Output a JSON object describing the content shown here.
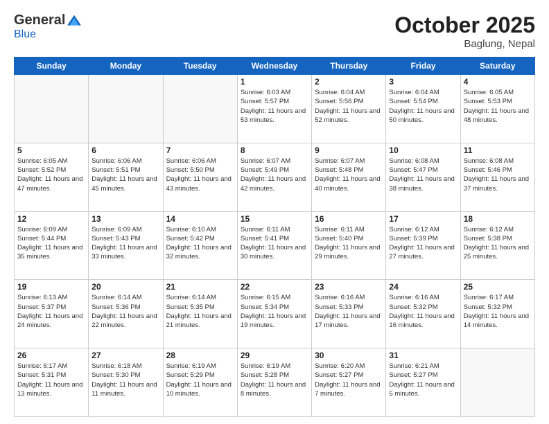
{
  "header": {
    "logo_general": "General",
    "logo_blue": "Blue",
    "title": "October 2025",
    "location": "Baglung, Nepal"
  },
  "calendar": {
    "days_of_week": [
      "Sunday",
      "Monday",
      "Tuesday",
      "Wednesday",
      "Thursday",
      "Friday",
      "Saturday"
    ],
    "weeks": [
      [
        {
          "day": "",
          "empty": true
        },
        {
          "day": "",
          "empty": true
        },
        {
          "day": "",
          "empty": true
        },
        {
          "day": "1",
          "sunrise": "6:03 AM",
          "sunset": "5:57 PM",
          "daylight": "11 hours and 53 minutes."
        },
        {
          "day": "2",
          "sunrise": "6:04 AM",
          "sunset": "5:56 PM",
          "daylight": "11 hours and 52 minutes."
        },
        {
          "day": "3",
          "sunrise": "6:04 AM",
          "sunset": "5:54 PM",
          "daylight": "11 hours and 50 minutes."
        },
        {
          "day": "4",
          "sunrise": "6:05 AM",
          "sunset": "5:53 PM",
          "daylight": "11 hours and 48 minutes."
        }
      ],
      [
        {
          "day": "5",
          "sunrise": "6:05 AM",
          "sunset": "5:52 PM",
          "daylight": "11 hours and 47 minutes."
        },
        {
          "day": "6",
          "sunrise": "6:06 AM",
          "sunset": "5:51 PM",
          "daylight": "11 hours and 45 minutes."
        },
        {
          "day": "7",
          "sunrise": "6:06 AM",
          "sunset": "5:50 PM",
          "daylight": "11 hours and 43 minutes."
        },
        {
          "day": "8",
          "sunrise": "6:07 AM",
          "sunset": "5:49 PM",
          "daylight": "11 hours and 42 minutes."
        },
        {
          "day": "9",
          "sunrise": "6:07 AM",
          "sunset": "5:48 PM",
          "daylight": "11 hours and 40 minutes."
        },
        {
          "day": "10",
          "sunrise": "6:08 AM",
          "sunset": "5:47 PM",
          "daylight": "11 hours and 38 minutes."
        },
        {
          "day": "11",
          "sunrise": "6:08 AM",
          "sunset": "5:46 PM",
          "daylight": "11 hours and 37 minutes."
        }
      ],
      [
        {
          "day": "12",
          "sunrise": "6:09 AM",
          "sunset": "5:44 PM",
          "daylight": "11 hours and 35 minutes."
        },
        {
          "day": "13",
          "sunrise": "6:09 AM",
          "sunset": "5:43 PM",
          "daylight": "11 hours and 33 minutes."
        },
        {
          "day": "14",
          "sunrise": "6:10 AM",
          "sunset": "5:42 PM",
          "daylight": "11 hours and 32 minutes."
        },
        {
          "day": "15",
          "sunrise": "6:11 AM",
          "sunset": "5:41 PM",
          "daylight": "11 hours and 30 minutes."
        },
        {
          "day": "16",
          "sunrise": "6:11 AM",
          "sunset": "5:40 PM",
          "daylight": "11 hours and 29 minutes."
        },
        {
          "day": "17",
          "sunrise": "6:12 AM",
          "sunset": "5:39 PM",
          "daylight": "11 hours and 27 minutes."
        },
        {
          "day": "18",
          "sunrise": "6:12 AM",
          "sunset": "5:38 PM",
          "daylight": "11 hours and 25 minutes."
        }
      ],
      [
        {
          "day": "19",
          "sunrise": "6:13 AM",
          "sunset": "5:37 PM",
          "daylight": "11 hours and 24 minutes."
        },
        {
          "day": "20",
          "sunrise": "6:14 AM",
          "sunset": "5:36 PM",
          "daylight": "11 hours and 22 minutes."
        },
        {
          "day": "21",
          "sunrise": "6:14 AM",
          "sunset": "5:35 PM",
          "daylight": "11 hours and 21 minutes."
        },
        {
          "day": "22",
          "sunrise": "6:15 AM",
          "sunset": "5:34 PM",
          "daylight": "11 hours and 19 minutes."
        },
        {
          "day": "23",
          "sunrise": "6:16 AM",
          "sunset": "5:33 PM",
          "daylight": "11 hours and 17 minutes."
        },
        {
          "day": "24",
          "sunrise": "6:16 AM",
          "sunset": "5:32 PM",
          "daylight": "11 hours and 16 minutes."
        },
        {
          "day": "25",
          "sunrise": "6:17 AM",
          "sunset": "5:32 PM",
          "daylight": "11 hours and 14 minutes."
        }
      ],
      [
        {
          "day": "26",
          "sunrise": "6:17 AM",
          "sunset": "5:31 PM",
          "daylight": "11 hours and 13 minutes."
        },
        {
          "day": "27",
          "sunrise": "6:18 AM",
          "sunset": "5:30 PM",
          "daylight": "11 hours and 11 minutes."
        },
        {
          "day": "28",
          "sunrise": "6:19 AM",
          "sunset": "5:29 PM",
          "daylight": "11 hours and 10 minutes."
        },
        {
          "day": "29",
          "sunrise": "6:19 AM",
          "sunset": "5:28 PM",
          "daylight": "11 hours and 8 minutes."
        },
        {
          "day": "30",
          "sunrise": "6:20 AM",
          "sunset": "5:27 PM",
          "daylight": "11 hours and 7 minutes."
        },
        {
          "day": "31",
          "sunrise": "6:21 AM",
          "sunset": "5:27 PM",
          "daylight": "11 hours and 5 minutes."
        },
        {
          "day": "",
          "empty": true
        }
      ]
    ]
  }
}
